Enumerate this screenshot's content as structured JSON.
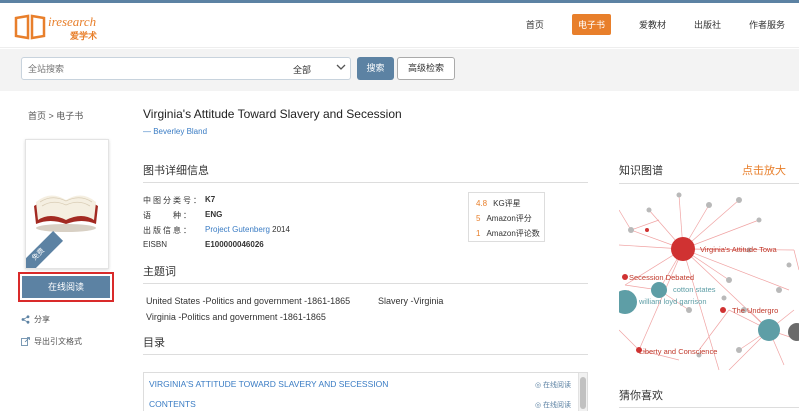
{
  "header": {
    "logo_text": "iresearch",
    "logo_cn": "爱学术",
    "nav": [
      "首页",
      "电子书",
      "爱教材",
      "出版社",
      "作者服务"
    ],
    "nav_active": "电子书"
  },
  "search": {
    "placeholder": "全站搜索",
    "scope": "全部",
    "search_label": "搜索",
    "advanced_label": "高级检索"
  },
  "breadcrumb": "首页 > 电子书",
  "cover": {
    "ribbon": "免费"
  },
  "actions": {
    "read_online": "在线阅读",
    "share": "分享",
    "export_citation": "导出引文格式"
  },
  "book": {
    "title": "Virginia's Attitude Toward Slavery and Secession",
    "author": "— Beverley Bland"
  },
  "details": {
    "section_title": "图书详细信息",
    "classification_label": "中图分类号：",
    "classification": "K7",
    "language_label": "语　　种：",
    "language": "ENG",
    "publisher_label": "出版信息：",
    "publisher_name": "Project Gutenberg",
    "publisher_year": " 2014",
    "eisbn_label": "EISBN",
    "eisbn": "E100000046026"
  },
  "stats": [
    {
      "num": "4.8",
      "label": "KG评星"
    },
    {
      "num": "5",
      "label": "Amazon评分"
    },
    {
      "num": "1",
      "label": "Amazon评论数"
    }
  ],
  "subjects": {
    "section_title": "主题词",
    "items": [
      "United States -Politics and government -1861-1865",
      "Slavery -Virginia",
      "Virginia -Politics and government -1861-1865"
    ]
  },
  "toc": {
    "section_title": "目录",
    "rows": [
      {
        "title": "VIRGINIA'S ATTITUDE TOWARD SLAVERY AND SECESSION",
        "action": "在线阅读"
      },
      {
        "title": "CONTENTS",
        "action": "在线阅读"
      }
    ]
  },
  "knowledge_graph": {
    "title": "知识图谱",
    "zoom": "点击放大",
    "labels": [
      "Virginia's Attitude Towa",
      "Secession Debated",
      "cotton states",
      "william loyd garrison",
      "The Undergro",
      "Liberty and Conscience"
    ],
    "colors": {
      "hub": "#d03232",
      "teal": "#5e9ea6",
      "grey": "#b9b9b9",
      "edge": "#f0a3a3"
    }
  },
  "recommend": {
    "title": "猜你喜欢"
  }
}
